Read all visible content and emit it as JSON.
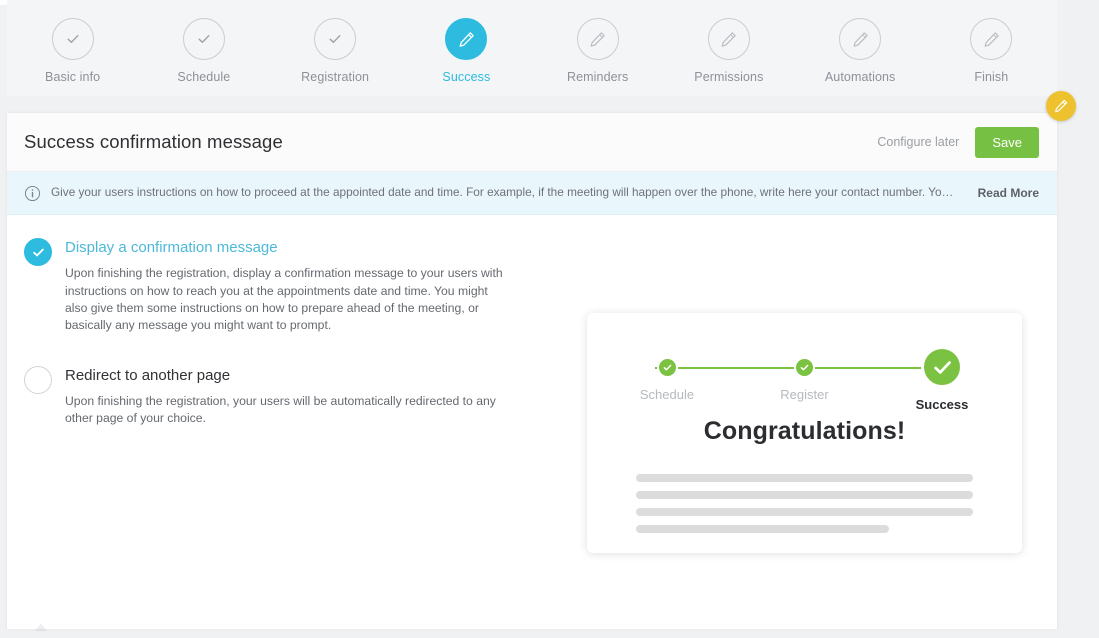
{
  "wizard": {
    "steps": [
      {
        "label": "Basic info",
        "state": "done",
        "icon": "check-icon"
      },
      {
        "label": "Schedule",
        "state": "done",
        "icon": "check-icon"
      },
      {
        "label": "Registration",
        "state": "done",
        "icon": "check-icon"
      },
      {
        "label": "Success",
        "state": "active",
        "icon": "pencil-icon"
      },
      {
        "label": "Reminders",
        "state": "pending",
        "icon": "pencil-icon"
      },
      {
        "label": "Permissions",
        "state": "pending",
        "icon": "pencil-icon"
      },
      {
        "label": "Automations",
        "state": "pending",
        "icon": "pencil-icon"
      },
      {
        "label": "Finish",
        "state": "pending",
        "icon": "pencil-icon"
      }
    ]
  },
  "header": {
    "title": "Success confirmation message",
    "configure_later_label": "Configure later",
    "save_label": "Save",
    "save_color": "#76c043",
    "fab_icon": "pencil-icon",
    "fab_color": "#edc22e"
  },
  "banner": {
    "icon": "info-icon",
    "text": "Give your users instructions on how to proceed at the appointed date and time. For example, if the meeting will happen over the phone, write here your contact number. You might a...",
    "read_more_label": "Read More",
    "background": "#e9f6fb"
  },
  "options": [
    {
      "title": "Display a confirmation message",
      "description": "Upon finishing the registration, display a confirmation message to your users with instructions on how to reach you at the appointments date and time. You might also give them some instructions on how to prepare ahead of the meeting, or basically any message you might want to prompt.",
      "selected": true
    },
    {
      "title": "Redirect to another page",
      "description": "Upon finishing the registration, your users will be automatically redirected to any other page of your choice.",
      "selected": false
    }
  ],
  "preview": {
    "steps": [
      {
        "label": "Schedule",
        "state": "done"
      },
      {
        "label": "Register",
        "state": "done"
      },
      {
        "label": "Success",
        "state": "current"
      }
    ],
    "heading": "Congratulations!",
    "accent_color": "#7cc242",
    "placeholder_lines": 4
  }
}
